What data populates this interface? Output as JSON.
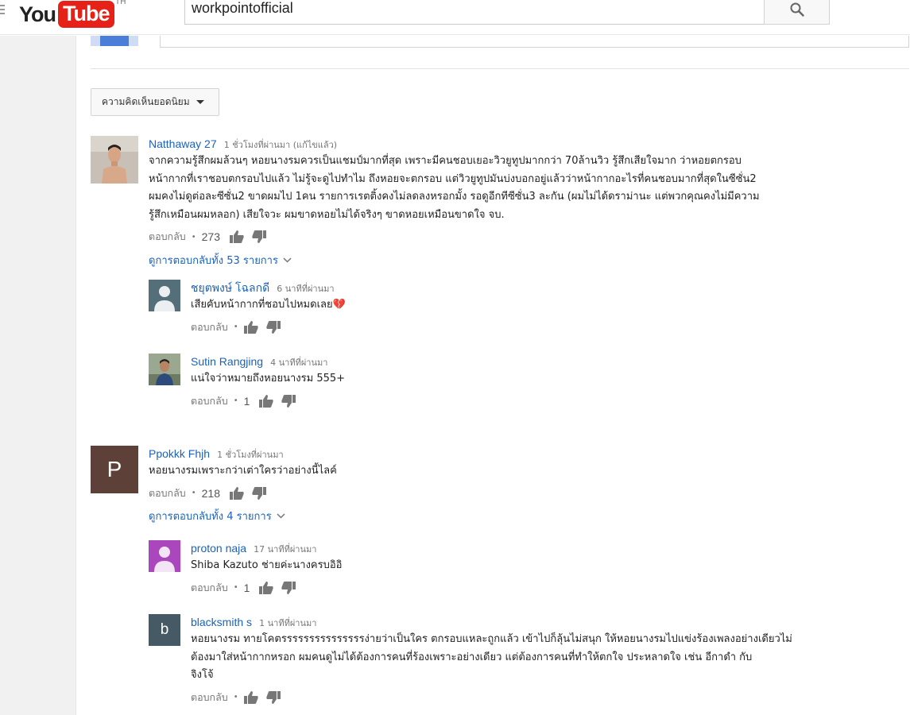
{
  "header": {
    "logo_you": "You",
    "logo_tube": "Tube",
    "logo_country": "TH",
    "search_value": "workpointofficial"
  },
  "sort": {
    "label": "ความคิดเห็นยอดนิยม"
  },
  "comments": [
    {
      "author": "Natthaway 27",
      "time": "1 ชั่วโมงที่ผ่านมา (แก้ไขแล้ว)",
      "text": "จากความรู้สึกผมล้วนๆ หอยนางรมควรเป็นแชมป์มากที่สุด เพราะมีคนชอบเยอะวิวยูทูปมากกว่า 70ล้านวิว รู้สึกเสียใจมาก ว่าหอยตกรอบ\nหน้ากากที่เราชอบตกรอบไปแล้ว ไม่รู้จะดูไปทำไม ถึงหอยจะตกรอบ แต่วิวยูทูปมันบ่งบอกอยู่แล้วว่าหน้ากากอะไรที่คนชอบมากที่สุดในซีซั่น2\nผมคงไม่ดูต่อละซีซั่น2 ขาดผมไป 1คน รายการเรตติ้งคงไม่ลดลงหรอกมั้ง รอดูอีกทีซีซั่น3 ละกัน (ผมไม่ได้ดราม่านะ แต่พวกคุณคงไม่มีความ\nรู้สึกเหมือนผมหลอก) เสียใจวะ ผมขาดหอยไม่ได้จริงๆ ขาดหอยเหมือนขาดใจ จบ.",
      "reply_label": "ตอบกลับ",
      "likes": "273",
      "view_replies": "ดูการตอบกลับทั้ง 53 รายการ",
      "replies": [
        {
          "author": "ชยุตพงษ์ โฉลกดี",
          "time": "6 นาทีที่ผ่านมา",
          "text": "เสียคับหน้ากากที่ชอบไปหมดเลย💔",
          "reply_label": "ตอบกลับ",
          "likes": ""
        },
        {
          "author": "Sutin Rangjing",
          "time": "4 นาทีที่ผ่านมา",
          "text": "แน่ใจว่าหมายถึงหอยนางรม 555+",
          "reply_label": "ตอบกลับ",
          "likes": "1"
        }
      ]
    },
    {
      "author": "Ppokkk Fhjh",
      "avatar_letter": "P",
      "time": "1 ชั่วโมงที่ผ่านมา",
      "text": "หอยนางรมเพราะกว่าเต่าใครว่าอย่างนี้ไลค์",
      "reply_label": "ตอบกลับ",
      "likes": "218",
      "view_replies": "ดูการตอบกลับทั้ง 4 รายการ",
      "replies": [
        {
          "author": "proton naja",
          "time": "17 นาทีที่ผ่านมา",
          "text": "Shiba Kazuto ช่ายค่ะนางครบอิอิ",
          "reply_label": "ตอบกลับ",
          "likes": "1"
        },
        {
          "author": "blacksmith s",
          "avatar_letter": "b",
          "time": "1 นาทีที่ผ่านมา",
          "text": "หอยนางรม ทายโคตรรรรรรรรรรรรรรรง่ายว่าเป็นใคร ตกรอบแหละถูกแล้ว เข้าไปก็ลุ้นไม่สนุก ให้หอยนางรมไปแข่งร้องเพลงอย่างเดียวไม่\nต้องมาใส่หน้ากากหรอก  ผมคนดูไม่ได้ต้องการคนที่ร้องเพราะอย่างเดียว แต่ต้องการคนที่ทำให้ตกใจ ประหลาดใจ เช่น อีกาดำ กับ\nจิงโจ้",
          "reply_label": "ตอบกลับ",
          "likes": ""
        }
      ]
    }
  ],
  "colors": {
    "link": "#1c62b9",
    "brand_red": "#e62117",
    "avatar_brown": "#5d4037",
    "avatar_purple": "#ab47bc",
    "avatar_slate": "#455a64"
  }
}
